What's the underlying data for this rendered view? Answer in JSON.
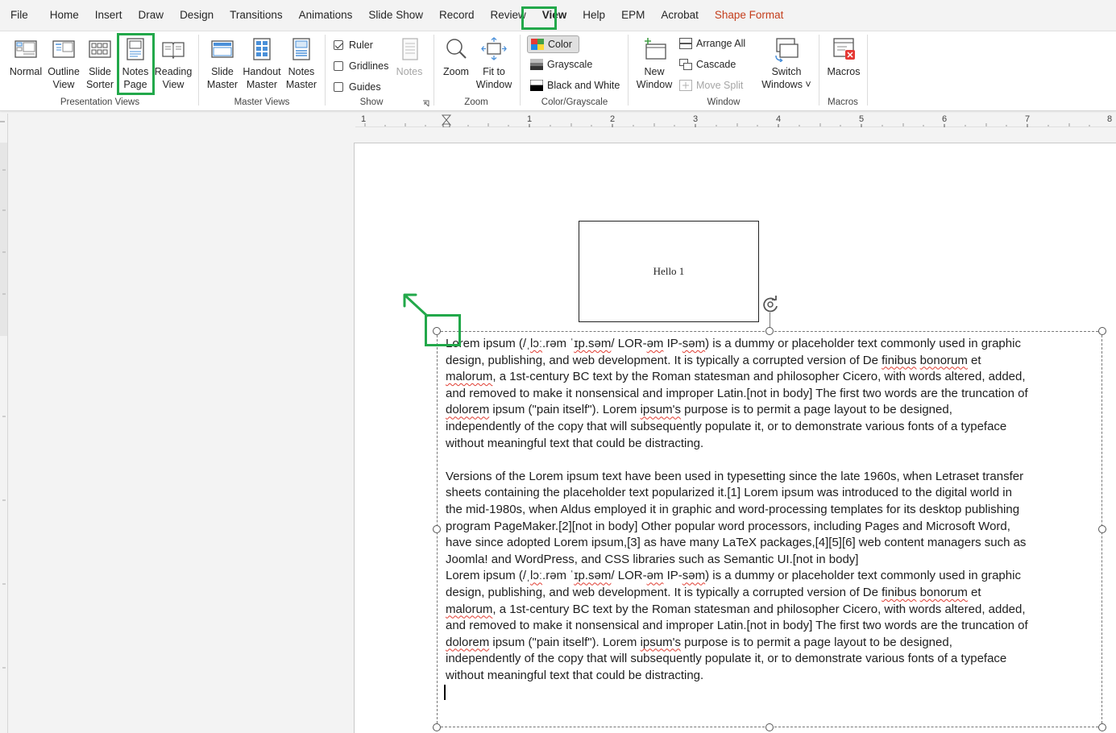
{
  "menu": {
    "tabs": [
      "File",
      "Home",
      "Insert",
      "Draw",
      "Design",
      "Transitions",
      "Animations",
      "Slide Show",
      "Record",
      "Review",
      "View",
      "Help",
      "EPM",
      "Acrobat",
      "Shape Format"
    ],
    "active_tab": "View"
  },
  "ribbon": {
    "presentation_views": {
      "label": "Presentation Views",
      "normal": "Normal",
      "outline_view": "Outline\nView",
      "slide_sorter": "Slide\nSorter",
      "notes_page": "Notes\nPage",
      "reading_view": "Reading\nView"
    },
    "master_views": {
      "label": "Master Views",
      "slide_master": "Slide\nMaster",
      "handout_master": "Handout\nMaster",
      "notes_master": "Notes\nMaster"
    },
    "show": {
      "label": "Show",
      "ruler": "Ruler",
      "ruler_checked": true,
      "gridlines": "Gridlines",
      "gridlines_checked": false,
      "guides": "Guides",
      "guides_checked": false,
      "notes": "Notes"
    },
    "zoom": {
      "label": "Zoom",
      "zoom": "Zoom",
      "fit_to_window": "Fit to\nWindow"
    },
    "color_grayscale": {
      "label": "Color/Grayscale",
      "color": "Color",
      "grayscale": "Grayscale",
      "black_and_white": "Black and White"
    },
    "window": {
      "label": "Window",
      "new_window": "New\nWindow",
      "arrange_all": "Arrange All",
      "cascade": "Cascade",
      "move_split": "Move Split",
      "switch_windows": "Switch\nWindows ˅"
    },
    "macros": {
      "label": "Macros",
      "macros": "Macros"
    }
  },
  "ruler": {
    "numbers": [
      "1",
      "1",
      "2",
      "3",
      "4",
      "5",
      "6",
      "7",
      "8"
    ]
  },
  "slide_thumbnail": {
    "text": "Hello 1"
  },
  "notes": {
    "p1_l1_a": "Lorem ipsum (/ˌ",
    "p1_l1_b": "lɔː",
    "p1_l1_c": ".rəm ˈ",
    "p1_l1_d": "ɪp.səm",
    "p1_l1_e": "/ LOR-",
    "p1_l1_f": "əm",
    "p1_l1_g": " IP-",
    "p1_l1_h": "səm",
    "p1_l1_i": ") is a dummy or placeholder text commonly used in graphic",
    "p1_l2_a": "design, publishing, and web development. It is typically a corrupted version of De ",
    "p1_l2_b": "finibus",
    "p1_l2_c": " ",
    "p1_l2_d": "bonorum",
    "p1_l2_e": " et",
    "p1_l3_a": "malorum",
    "p1_l3_b": ", a 1st-century BC text by the Roman statesman and philosopher Cicero, with words altered, added,",
    "p1_l4": "and removed to make it nonsensical and improper Latin.[not in body] The first two words are the truncation of",
    "p1_l5_a": "dolorem",
    "p1_l5_b": " ipsum (\"pain itself\"). Lorem ",
    "p1_l5_c": "ipsum's",
    "p1_l5_d": " purpose is to permit a page layout to be designed,",
    "p1_l6": "independently of the copy that will subsequently populate it, or to demonstrate various fonts of a typeface",
    "p1_l7": "without meaningful text that could be distracting.",
    "p2_l1": "Versions of the Lorem ipsum text have been used in typesetting since the late 1960s, when Letraset transfer",
    "p2_l2": "sheets containing the placeholder text popularized it.[1] Lorem ipsum was introduced to the digital world in",
    "p2_l3": "the mid-1980s, when Aldus employed it in graphic and word-processing templates for its desktop publishing",
    "p2_l4": "program PageMaker.[2][not in body] Other popular word processors, including Pages and Microsoft Word,",
    "p2_l5": "have since adopted Lorem ipsum,[3] as have many LaTeX packages,[4][5][6] web content managers such as",
    "p2_l6": "Joomla! and WordPress, and CSS libraries such as Semantic UI.[not in body]"
  },
  "colors": {
    "highlight": "#22a84a",
    "shape_format": "#c43e1c",
    "spellcheck": "#e03c31"
  }
}
